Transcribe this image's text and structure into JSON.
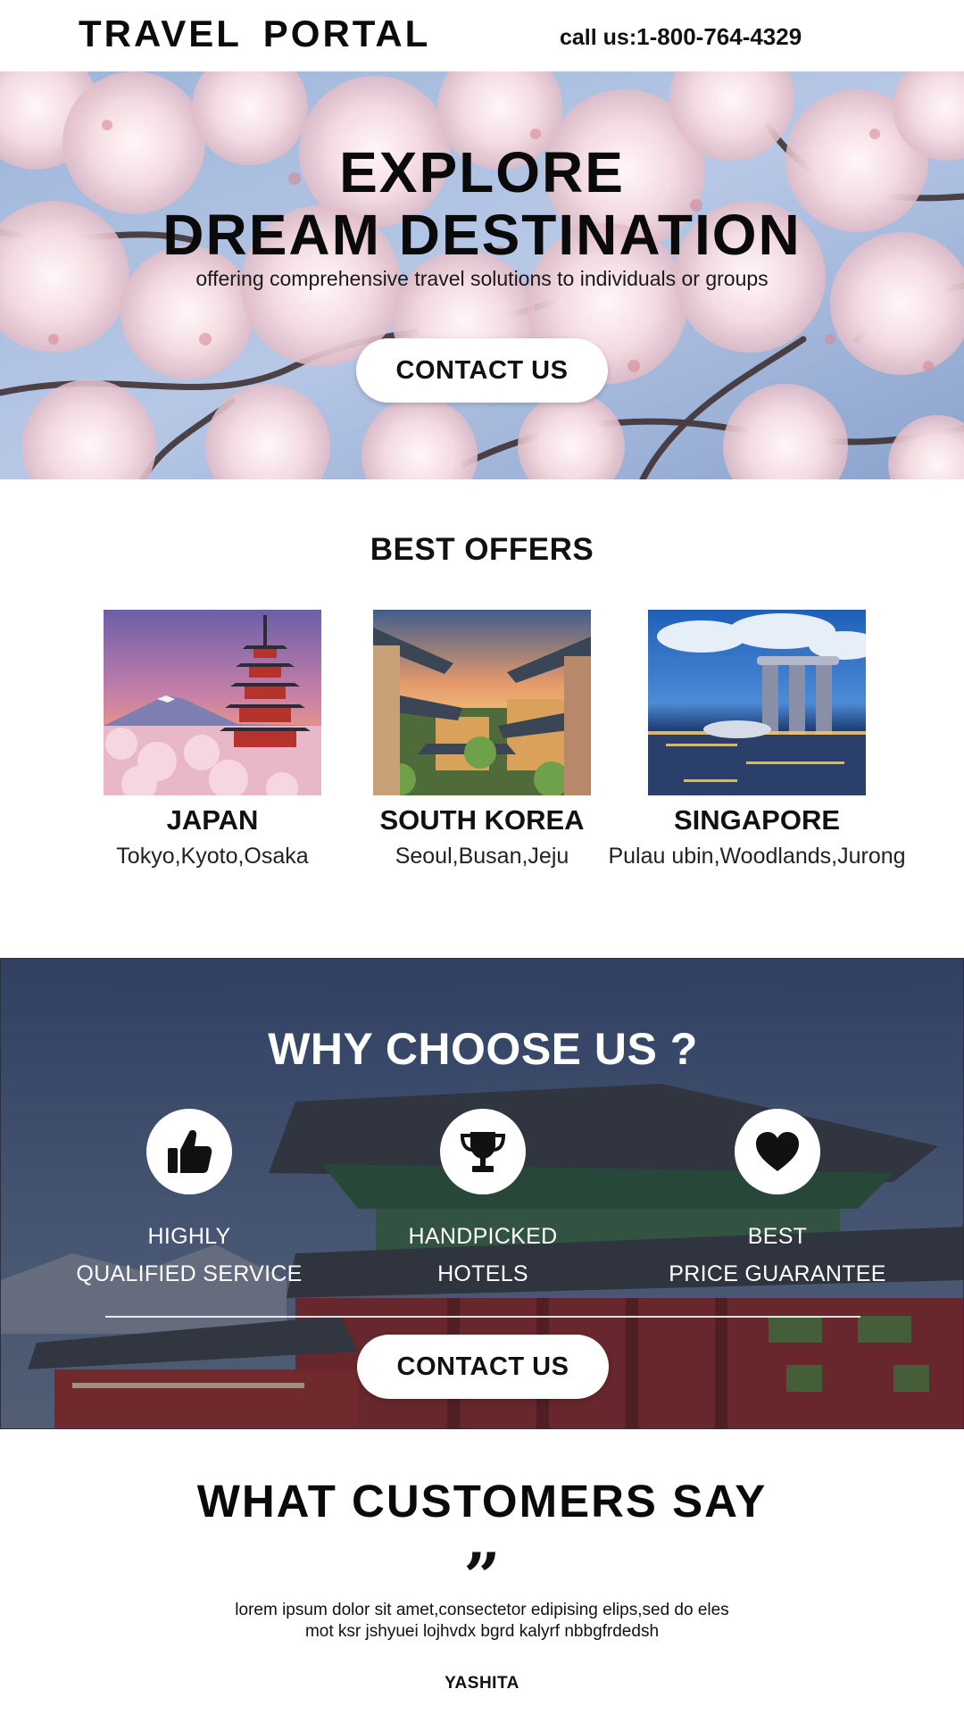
{
  "header": {
    "logo": "TRAVEL  PORTAL",
    "phone_label": "call us:",
    "phone_number": "1-800-764-4329"
  },
  "hero": {
    "title_line1": "EXPLORE",
    "title_line2": "DREAM DESTINATION",
    "subtitle": "offering comprehensive travel solutions to individuals or groups",
    "cta_label": "CONTACT US",
    "background": "cherry-blossom-photo"
  },
  "offers": {
    "title": "BEST OFFERS",
    "items": [
      {
        "name": "JAPAN",
        "cities": "Tokyo,Kyoto,Osaka",
        "image": "mount-fuji-pagoda-photo"
      },
      {
        "name": "SOUTH KOREA",
        "cities": "Seoul,Busan,Jeju",
        "image": "korean-hanok-rooftops-photo"
      },
      {
        "name": "SINGAPORE",
        "cities": "Pulau ubin,Woodlands,Jurong",
        "image": "marina-bay-sands-photo"
      }
    ]
  },
  "why": {
    "title": "WHY CHOOSE US ?",
    "background": "korean-palace-photo",
    "features": [
      {
        "line1": "HIGHLY",
        "line2": "QUALIFIED SERVICE",
        "icon": "thumbs-up-icon"
      },
      {
        "line1": "HANDPICKED",
        "line2": "HOTELS",
        "icon": "trophy-icon"
      },
      {
        "line1": "BEST",
        "line2": "PRICE GUARANTEE",
        "icon": "heart-icon"
      }
    ],
    "cta_label": "CONTACT US"
  },
  "testimonials": {
    "title": "WHAT CUSTOMERS SAY",
    "quote_mark": "”",
    "text_line1": "lorem ipsum dolor sit amet,consectetor edipising elips,sed do eles",
    "text_line2": "mot ksr jshyuei lojhvdx bgrd kalyrf nbbgfrdedsh",
    "author": "YASHITA"
  }
}
